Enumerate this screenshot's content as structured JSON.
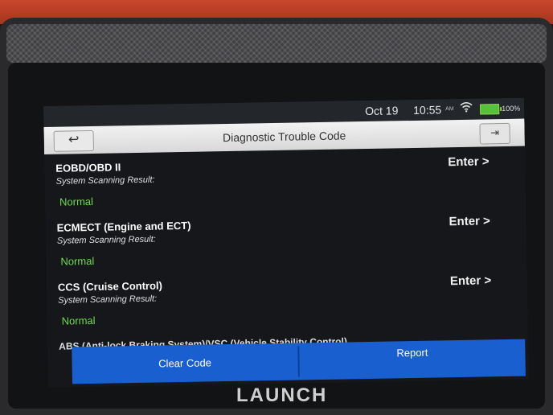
{
  "status_bar": {
    "date": "Oct 19",
    "time": "10:55",
    "ampm": "AM",
    "battery": "100%"
  },
  "header": {
    "title": "Diagnostic Trouble Code",
    "back_glyph": "↩",
    "exit_glyph": "⇥"
  },
  "systems": [
    {
      "name": "EOBD/OBD II",
      "label": "System Scanning Result:",
      "status": "Normal",
      "action": "Enter >"
    },
    {
      "name": "ECMECT (Engine and ECT)",
      "label": "System Scanning Result:",
      "status": "Normal",
      "action": "Enter >"
    },
    {
      "name": "CCS (Cruise Control)",
      "label": "System Scanning Result:",
      "status": "Normal",
      "action": "Enter >"
    }
  ],
  "partial_item": "ABS (Anti-lock Braking System)/VSC (Vehicle Stability Control)",
  "footer": {
    "clear_label": "Clear Code",
    "report_label": "Report"
  },
  "brand": "LAUNCH",
  "colors": {
    "accent": "#1a5fcf",
    "status_ok": "#6ddb4a",
    "bezel_orange": "#c7472b"
  }
}
